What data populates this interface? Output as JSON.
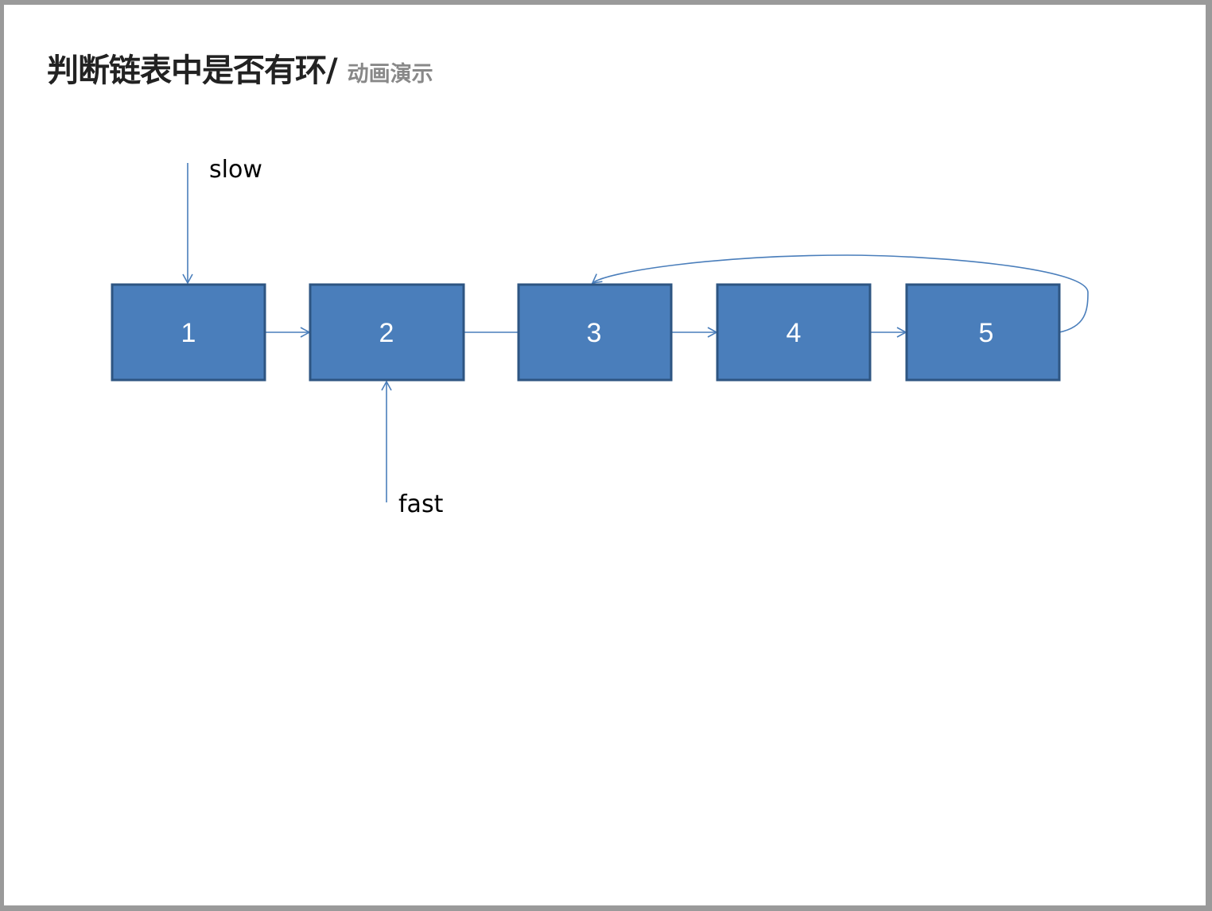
{
  "title": {
    "main": "判断链表中是否有环",
    "separator": "/",
    "sub": "动画演示"
  },
  "diagram": {
    "nodes": [
      "1",
      "2",
      "3",
      "4",
      "5"
    ],
    "pointers": {
      "slow": {
        "label": "slow",
        "target_node": "1"
      },
      "fast": {
        "label": "fast",
        "target_node": "2"
      }
    },
    "edges": [
      [
        "1",
        "2"
      ],
      [
        "2",
        "3"
      ],
      [
        "3",
        "4"
      ],
      [
        "4",
        "5"
      ],
      [
        "5",
        "3"
      ]
    ],
    "node_color": "#4a7ebb",
    "edge_color": "#4a7ebb"
  }
}
